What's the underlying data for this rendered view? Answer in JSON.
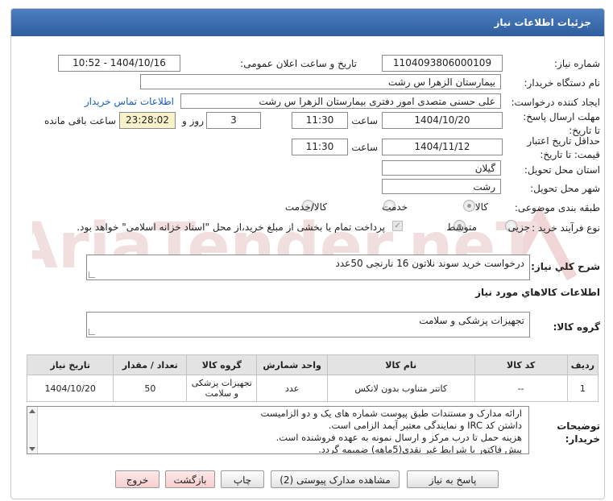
{
  "panel": {
    "title": "جزئیات اطلاعات نیاز"
  },
  "fields": {
    "need_number_label": "شماره نیاز:",
    "need_number": "1104093806000109",
    "announce_label": "تاریخ و ساعت اعلان عمومی:",
    "announce_value": "1404/10/16 - 10:52",
    "buyer_org_label": "نام دستگاه خریدار:",
    "buyer_org": "بیمارستان الزهرا  س  رشت",
    "creator_label": "ایجاد کننده درخواست:",
    "creator": "علی حسنی متصدی امور دفتری بیمارستان الزهرا  س  رشت",
    "contact_link": "اطلاعات تماس خریدار",
    "deadline_label": "مهلت ارسال پاسخ: تا تاریخ:",
    "deadline_date": "1404/10/20",
    "time_label": "ساعت",
    "deadline_time": "11:30",
    "days_value": "3",
    "days_label": "روز و",
    "remaining_time": "23:28:02",
    "remaining_label": "ساعت باقی مانده",
    "validity_label": "حداقل تاریخ اعتبار قیمت: تا تاریخ:",
    "validity_date": "1404/11/12",
    "validity_time": "11:30",
    "province_label": "استان محل تحویل:",
    "province": "گیلان",
    "city_label": "شهر محل تحویل:",
    "city": "رشت",
    "category_label": "طبقه بندی موضوعی:",
    "category_options": [
      "کالا",
      "خدمت",
      "کالا/خدمت"
    ],
    "purchase_type_label": "نوع فرآیند خرید :",
    "purchase_options": [
      "جزیی",
      "متوسط"
    ],
    "payment_note": "پرداخت تمام یا بخشی از مبلغ خرید،از محل \"اسناد خزانه اسلامی\" خواهد بود."
  },
  "general_desc": {
    "label": "شرح كلي نياز:",
    "value": "درخواست خرید سوند نلاتون 16 نارنجی    50عدد"
  },
  "goods_info": {
    "heading": "اطلاعات كالاهاي مورد نياز",
    "group_label": "گروه كالا:",
    "group_value": "تجهیزات پزشکی و سلامت"
  },
  "table": {
    "headers": [
      "ردیف",
      "کد کالا",
      "نام کالا",
      "واحد شمارش",
      "گروه کالا",
      "تعداد / مقدار",
      "تاریخ نیاز"
    ],
    "rows": [
      [
        "1",
        "--",
        "کاتتر متناوب بدون لاتکس",
        "عدد",
        "تجهیزات پزشکی و سلامت",
        "50",
        "1404/10/20"
      ]
    ]
  },
  "buyer_notes": {
    "label": "توضیحات خریدار:",
    "lines": [
      "ارائه مدارک و مستندات طبق پیوست شماره های یک و دو الزامیست",
      "داشتن کد IRC و نمایندگی معتبر آیمد الزامی است.",
      "هزینه حمل تا درب مرکز و ارسال نمونه به عهده فروشنده است.",
      "پیش فاکتور با شرایط غیر نقدی(5ماهه) ضمیمه گردد."
    ]
  },
  "buttons": {
    "reply": "پاسخ به نیاز",
    "attachments": "مشاهده مدارک پیوستی (2)",
    "print": "چاپ",
    "back": "بازگشت",
    "exit": "خروج"
  },
  "watermark_text": "AriaTender.neT",
  "colors": {
    "titlebar": "#3a6aad",
    "link": "#1a5fb4",
    "watermark": "#f0d8d8"
  }
}
